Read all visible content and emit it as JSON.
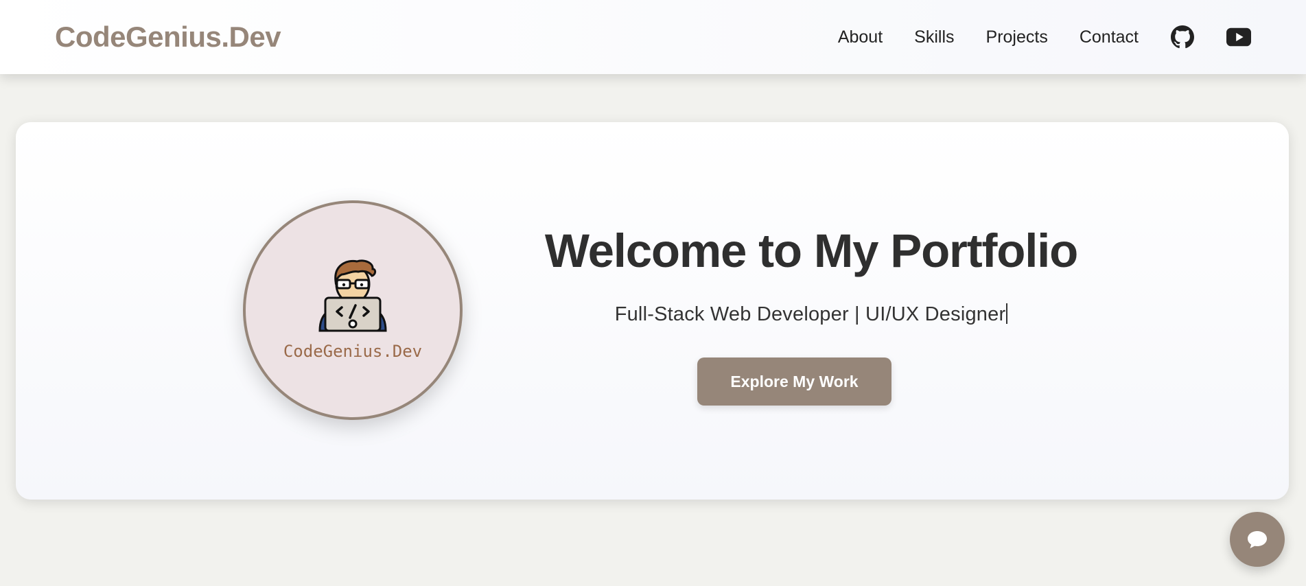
{
  "header": {
    "logo": "CodeGenius.Dev",
    "nav": [
      "About",
      "Skills",
      "Projects",
      "Contact"
    ],
    "icons": [
      "github-icon",
      "youtube-icon"
    ]
  },
  "hero": {
    "avatar_caption": "CodeGenius.Dev",
    "title": "Welcome to My Portfolio",
    "subtitle": "Full-Stack Web Developer | UI/UX Designer",
    "cta_label": "Explore My Work"
  },
  "chat": {
    "icon": "chat-bubble-icon"
  },
  "colors": {
    "accent": "#968679",
    "background": "#f2f2ee",
    "avatar_bg": "#ede2e4",
    "text": "#2f2f2f"
  }
}
